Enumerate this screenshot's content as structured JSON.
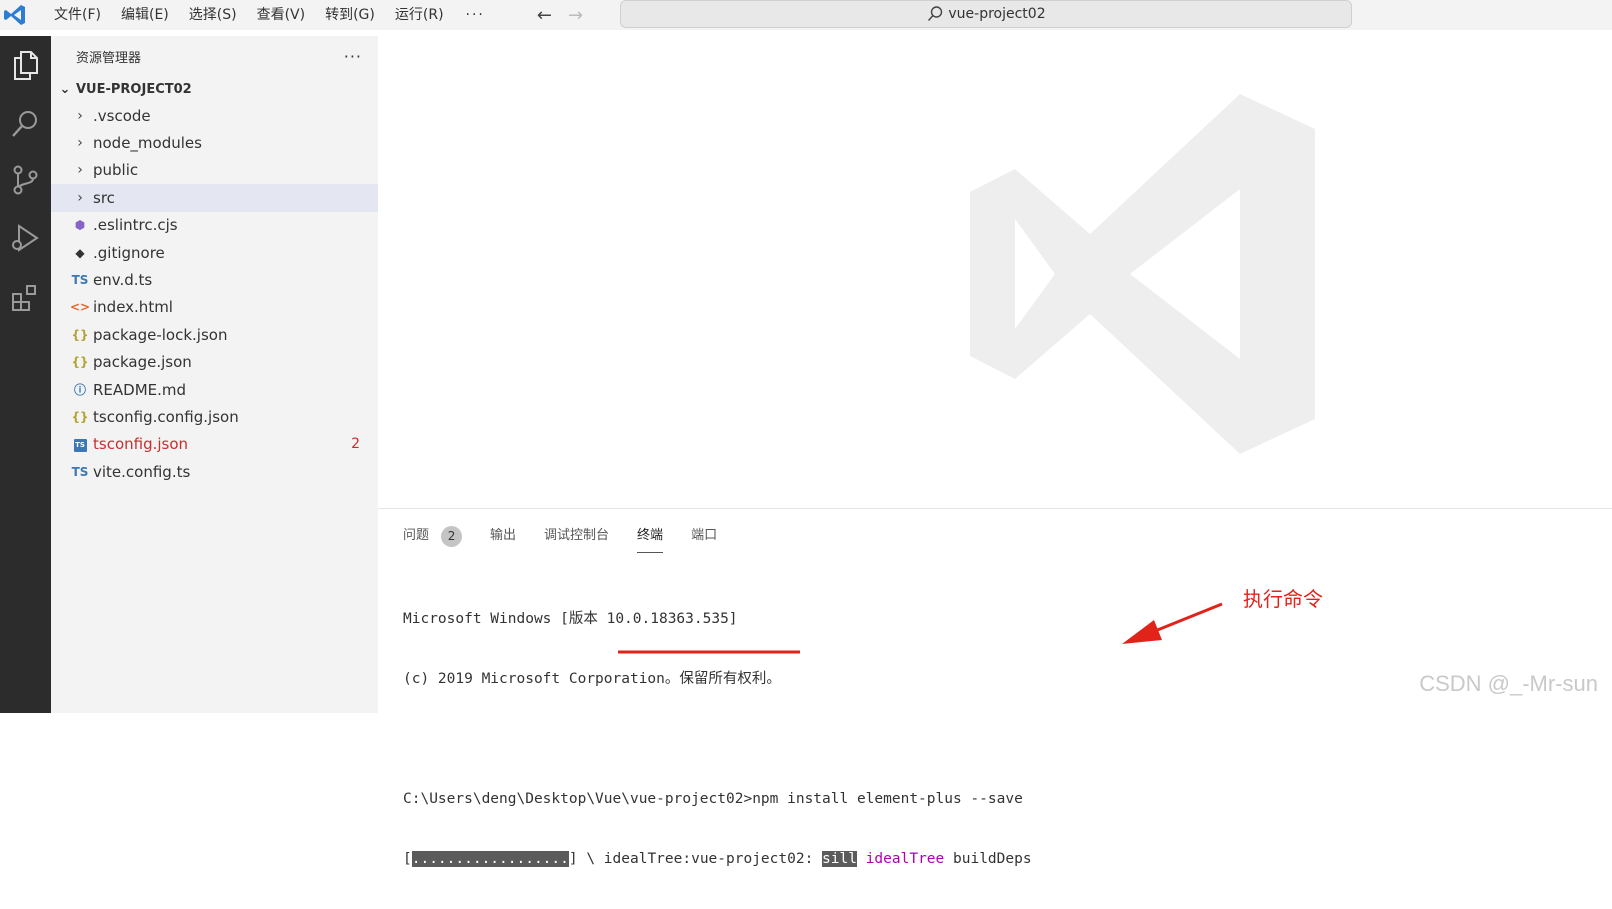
{
  "titlebar": {
    "menu": [
      "文件(F)",
      "编辑(E)",
      "选择(S)",
      "查看(V)",
      "转到(G)",
      "运行(R)"
    ],
    "more": "···",
    "search": "vue-project02"
  },
  "sidebar": {
    "title": "资源管理器",
    "more": "···",
    "project": "VUE-PROJECT02",
    "folders": [
      ".vscode",
      "node_modules",
      "public",
      "src"
    ],
    "files": [
      {
        "name": ".eslintrc.cjs",
        "icon": "eslint-icon",
        "glyph": "⬢",
        "color": "#8a63c7"
      },
      {
        "name": ".gitignore",
        "icon": "git-icon",
        "glyph": "◆",
        "color": "#333333"
      },
      {
        "name": "env.d.ts",
        "icon": "ts-icon",
        "glyph": "TS",
        "color": "#3c78b5"
      },
      {
        "name": "index.html",
        "icon": "html-icon",
        "glyph": "<>",
        "color": "#e2672f"
      },
      {
        "name": "package-lock.json",
        "icon": "json-icon",
        "glyph": "{}",
        "color": "#b3a332"
      },
      {
        "name": "package.json",
        "icon": "json-icon",
        "glyph": "{}",
        "color": "#b3a332"
      },
      {
        "name": "README.md",
        "icon": "info-icon",
        "glyph": "ⓘ",
        "color": "#3c78b5"
      },
      {
        "name": "tsconfig.config.json",
        "icon": "json-icon",
        "glyph": "{}",
        "color": "#b3a332"
      },
      {
        "name": "tsconfig.json",
        "icon": "tsconfig-icon",
        "glyph": "TS",
        "color": "#3c78b5",
        "error_count": "2"
      },
      {
        "name": "vite.config.ts",
        "icon": "ts-icon",
        "glyph": "TS",
        "color": "#3c78b5"
      }
    ]
  },
  "panel": {
    "tabs": {
      "problems": "问题",
      "problems_count": "2",
      "output": "输出",
      "debug_console": "调试控制台",
      "terminal": "终端",
      "ports": "端口"
    },
    "terminal": {
      "line1": "Microsoft Windows [版本 10.0.18363.535]",
      "line2": "(c) 2019 Microsoft Corporation。保留所有权利。",
      "prompt": "C:\\Users\\deng\\Desktop\\Vue\\vue-project02>npm install element-plus --save",
      "progress_open": "[",
      "progress_bar": "..................",
      "progress_close": "] \\ idealTree:vue-project02: ",
      "sill": "sill",
      "ideal_tree": "idealTree",
      "build_deps": " buildDeps"
    }
  },
  "annotation": {
    "text": "执行命令",
    "color": "#e2231a"
  },
  "watermark": "CSDN @_-Mr-sun"
}
